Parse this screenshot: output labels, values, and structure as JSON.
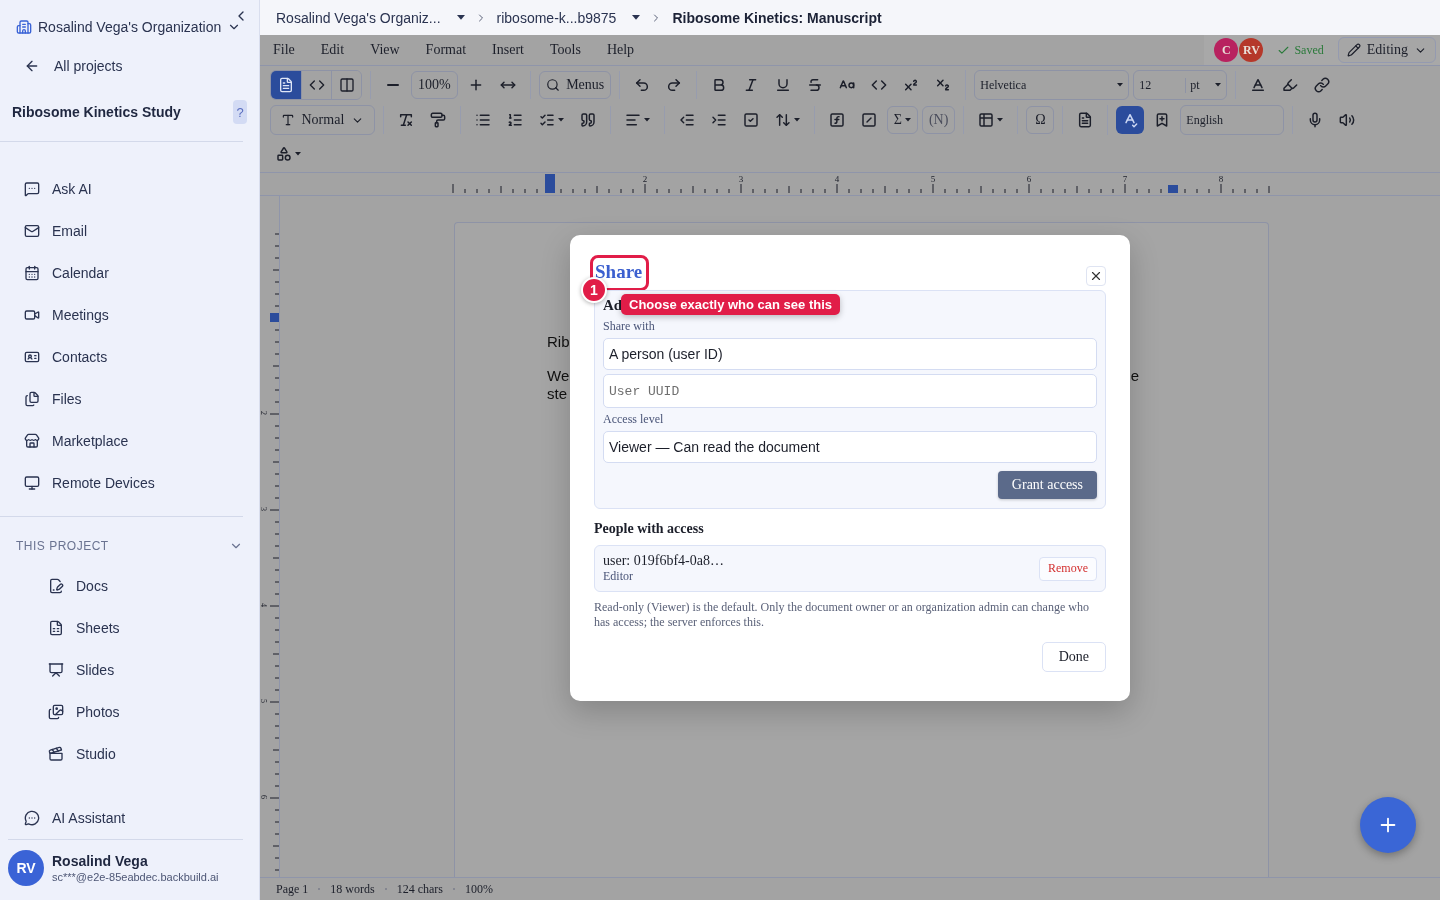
{
  "sidebar": {
    "organization": "Rosalind Vega's Organization",
    "back_link": "All projects",
    "project": "Ribosome Kinetics Study",
    "help_badge": "?",
    "nav": [
      {
        "label": "Ask AI"
      },
      {
        "label": "Email"
      },
      {
        "label": "Calendar"
      },
      {
        "label": "Meetings"
      },
      {
        "label": "Contacts"
      },
      {
        "label": "Files"
      },
      {
        "label": "Marketplace"
      },
      {
        "label": "Remote Devices"
      }
    ],
    "section": {
      "title": "THIS PROJECT",
      "expanded": true
    },
    "project_items": [
      {
        "label": "Docs"
      },
      {
        "label": "Sheets"
      },
      {
        "label": "Slides"
      },
      {
        "label": "Photos"
      },
      {
        "label": "Studio"
      }
    ],
    "assistant": "AI Assistant",
    "user": {
      "initials": "RV",
      "name": "Rosalind Vega",
      "email": "sc***@e2e-85eabdec.backbuild.ai"
    }
  },
  "breadcrumb": [
    {
      "label": "Rosalind Vega's Organiz...",
      "dropdown": true
    },
    {
      "label": "ribosome-k...b9875",
      "dropdown": true
    },
    {
      "label": "Ribosome Kinetics: Manuscript",
      "dropdown": false
    }
  ],
  "menu": [
    "File",
    "Edit",
    "View",
    "Format",
    "Insert",
    "Tools",
    "Help"
  ],
  "collaborators": [
    {
      "initials": "C",
      "color": "#b8225f"
    },
    {
      "initials": "RV",
      "color": "#b5382a"
    }
  ],
  "save_status": "Saved",
  "mode": "Editing",
  "toolbar": {
    "top": [
      {
        "kind": "view",
        "selected": true
      },
      {
        "kind": "view",
        "selected": false
      },
      {
        "kind": "view",
        "selected": false
      },
      {
        "kind": "divider"
      },
      {
        "kind": "icon"
      },
      {
        "kind": "text",
        "label": "100%"
      },
      {
        "kind": "icon"
      },
      {
        "kind": "icon"
      },
      {
        "kind": "divider"
      },
      {
        "kind": "button",
        "label": "Menus"
      },
      {
        "kind": "divider"
      },
      {
        "kind": "icon"
      },
      {
        "kind": "icon"
      },
      {
        "kind": "divider"
      },
      {
        "kind": "icon"
      },
      {
        "kind": "icon"
      },
      {
        "kind": "icon"
      },
      {
        "kind": "icon"
      },
      {
        "kind": "icon"
      },
      {
        "kind": "icon"
      },
      {
        "kind": "icon"
      },
      {
        "kind": "icon"
      },
      {
        "kind": "divider"
      },
      {
        "kind": "select",
        "value": "Helvetica"
      },
      {
        "kind": "size",
        "value": "12",
        "unit": "pt"
      },
      {
        "kind": "divider"
      },
      {
        "kind": "icon"
      },
      {
        "kind": "icon"
      },
      {
        "kind": "icon"
      }
    ],
    "middle": [
      {
        "kind": "style",
        "label": "Normal"
      },
      {
        "kind": "divider"
      },
      {
        "kind": "icon"
      },
      {
        "kind": "icon"
      },
      {
        "kind": "divider"
      },
      {
        "kind": "icon"
      },
      {
        "kind": "icon"
      },
      {
        "kind": "icon",
        "dropdown": true
      },
      {
        "kind": "icon"
      },
      {
        "kind": "divider"
      },
      {
        "kind": "icon",
        "dropdown": true
      },
      {
        "kind": "divider"
      },
      {
        "kind": "icon"
      },
      {
        "kind": "icon"
      },
      {
        "kind": "icon"
      },
      {
        "kind": "icon",
        "dropdown": true
      },
      {
        "kind": "divider"
      },
      {
        "kind": "icon"
      },
      {
        "kind": "icon"
      },
      {
        "kind": "text",
        "label": "Σ",
        "dropdown": true
      },
      {
        "kind": "text",
        "label": "(N)",
        "disabled": true
      },
      {
        "kind": "divider"
      },
      {
        "kind": "icon",
        "dropdown": true
      },
      {
        "kind": "divider"
      },
      {
        "kind": "text",
        "label": "Ω"
      },
      {
        "kind": "divider"
      },
      {
        "kind": "icon"
      },
      {
        "kind": "divider"
      },
      {
        "kind": "icon",
        "on": true
      },
      {
        "kind": "icon"
      },
      {
        "kind": "field",
        "value": "English"
      },
      {
        "kind": "divider"
      },
      {
        "kind": "icon"
      },
      {
        "kind": "icon"
      }
    ],
    "bottom": [
      {
        "kind": "icon",
        "dropdown": true
      }
    ]
  },
  "ruler": {
    "horizontal": [
      "2",
      "3",
      "4",
      "5",
      "6",
      "7",
      "8"
    ],
    "vertical": [
      "2",
      "3",
      "4",
      "5",
      "6"
    ]
  },
  "document": {
    "fragments": [
      {
        "left": "Rib"
      },
      {
        "left": "We",
        "right": "e"
      },
      {
        "left": "ste"
      }
    ]
  },
  "status_bar": [
    "Page 1",
    "18 words",
    "124 chars",
    "100%"
  ],
  "dialog": {
    "title": "Share",
    "section_title": "Ad",
    "share_with_label": "Share with",
    "share_with": "A person (user ID)",
    "uuid_placeholder": "User UUID",
    "access_label": "Access level",
    "access": "Viewer — Can read the document",
    "grant": "Grant access",
    "people_title": "People with access",
    "people": [
      {
        "user": "user: 019f6bf4-0a8…",
        "role": "Editor",
        "action": "Remove"
      }
    ],
    "note": "Read-only (Viewer) is the default. Only the document owner or an organization admin can change who has access; the server enforces this.",
    "done": "Done"
  },
  "tour": {
    "step": "1",
    "tip": "Choose exactly who can see this"
  }
}
